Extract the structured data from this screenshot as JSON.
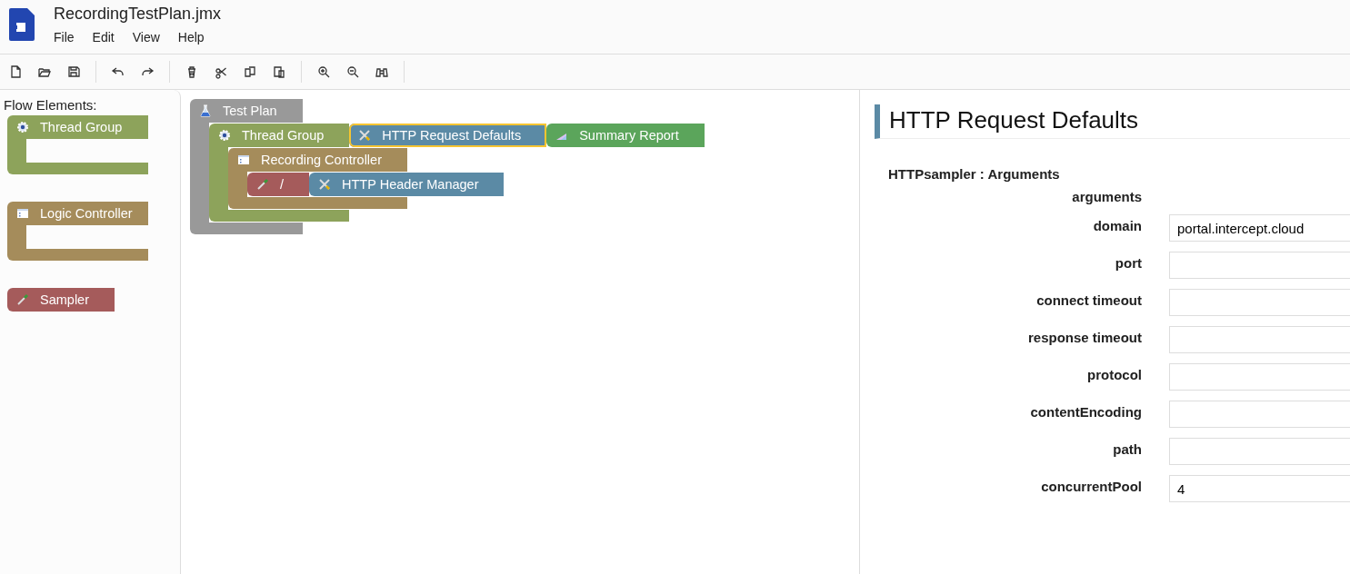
{
  "window": {
    "title": "RecordingTestPlan.jmx"
  },
  "menu": [
    {
      "label": "File"
    },
    {
      "label": "Edit"
    },
    {
      "label": "View"
    },
    {
      "label": "Help"
    }
  ],
  "sidebar": {
    "title": "Flow Elements:",
    "items": [
      {
        "kind": "thread-group",
        "label": "Thread Group"
      },
      {
        "kind": "controller",
        "label": "Logic Controller"
      },
      {
        "kind": "sampler",
        "label": "Sampler"
      }
    ]
  },
  "canvas": {
    "blocks": [
      {
        "kind": "test-plan",
        "label": "Test Plan",
        "selected": false,
        "children": [
          {
            "kind": "thread-group",
            "label": "Thread Group",
            "selected": false,
            "next": [
              {
                "kind": "config",
                "label": "HTTP Request Defaults",
                "selected": true
              },
              {
                "kind": "listener",
                "label": "Summary Report",
                "selected": false
              }
            ],
            "children": [
              {
                "kind": "controller",
                "label": "Recording Controller",
                "selected": false,
                "children": [
                  {
                    "kind": "sampler",
                    "label": "/",
                    "selected": false,
                    "next": [
                      {
                        "kind": "config",
                        "label": "HTTP Header Manager",
                        "selected": false
                      }
                    ]
                  }
                ]
              }
            ]
          }
        ]
      }
    ]
  },
  "properties": {
    "title": "HTTP Request Defaults",
    "section": "HTTPsampler : Arguments",
    "group_label": "arguments",
    "fields": [
      {
        "label": "domain",
        "value": "portal.intercept.cloud"
      },
      {
        "label": "port"
      },
      {
        "label": "connect timeout"
      },
      {
        "label": "response timeout"
      },
      {
        "label": "protocol"
      },
      {
        "label": "contentEncoding"
      },
      {
        "label": "path"
      },
      {
        "label": "concurrentPool",
        "value": "4"
      }
    ]
  }
}
